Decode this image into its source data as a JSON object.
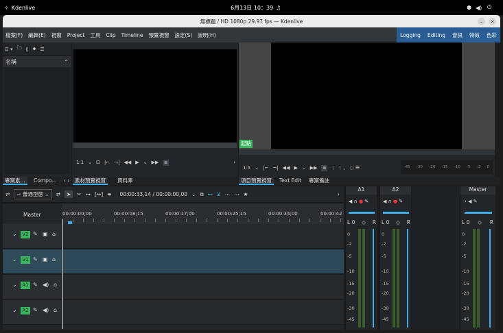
{
  "system": {
    "app": "Kdenlive",
    "clock": "6月13日 10：39"
  },
  "window": {
    "title": "無標題 / HD 1080p 29.97 fps — Kdenlive"
  },
  "menu": [
    "檔案(F)",
    "編輯(E)",
    "視窗",
    "Project",
    "工具",
    "Clip",
    "Timeline",
    "預覽視窗",
    "設定(S)",
    "說明(H)"
  ],
  "workspaces": [
    "Logging",
    "Editing",
    "音訊",
    "特效",
    "色彩"
  ],
  "bin": {
    "header": "名稱"
  },
  "clip_monitor": {
    "zoom": "1:1"
  },
  "project_monitor": {
    "zoom": "1:1",
    "marker": "起點",
    "dots": "⋮ ⋮ ,"
  },
  "left_tabs": {
    "t1": "專案素...",
    "t2": "Compo..."
  },
  "monitor_tabs": {
    "t1": "素材預覽視窗",
    "t2": "資料庫"
  },
  "right_tabs": {
    "t1": "項目預覽視窗",
    "t2": "Text Edit",
    "t3": "專案備註"
  },
  "timeline": {
    "mode": "普通型態",
    "timecode": "00:00:33,14 / 00:00:00,00",
    "master": "Master",
    "ruler": [
      "00:00:00;00",
      "00:00:08;15",
      "00:00:17;00",
      "00:00:25;15",
      "00:00:34;00",
      "00:00:42"
    ],
    "tracks": [
      "V2",
      "V1",
      "A1",
      "A2"
    ]
  },
  "mixer": {
    "channels": [
      "A1",
      "A2",
      "Master"
    ],
    "scale": [
      "0",
      "-2",
      "-5",
      "-10",
      "-15",
      "-20",
      "-30",
      "-45"
    ],
    "lr": {
      "l": "L 0",
      "r": "R"
    },
    "audio_scale": [
      "-45",
      "-30",
      "-20",
      "-15",
      "-10",
      "-5",
      "-2",
      "0"
    ]
  },
  "colors": {
    "accent": "#3daee9",
    "track_green": "#3ab45e",
    "menubar": "#31363b",
    "workspace": "#2a5d93"
  }
}
